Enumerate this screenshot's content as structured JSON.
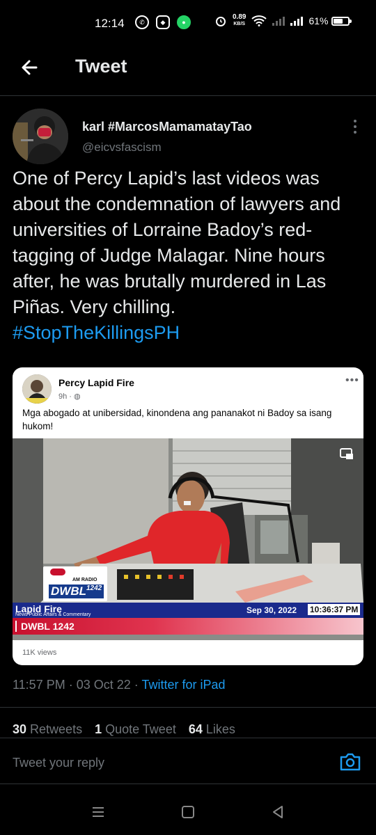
{
  "status_bar": {
    "time": "12:14",
    "speed_value": "0.89",
    "speed_unit": "KB/S",
    "battery": "61%"
  },
  "header": {
    "title": "Tweet",
    "back_icon": "arrow-left-icon"
  },
  "tweet": {
    "author_name": "karl #MarcosMamamatayTao",
    "author_handle": "@eicvsfascism",
    "text": "One of Percy Lapid’s last videos was about the condemnation of lawyers and universities of Lorraine Badoy’s red-tagging of Judge Malagar. Nine hours after, he was brutally murdered in Las Piñas. Very chilling.",
    "hashtag": "#StopTheKillingsPH",
    "timestamp": "11:57 PM · 03 Oct 22 · ",
    "client": "Twitter for iPad"
  },
  "embed": {
    "page_name": "Percy Lapid Fire",
    "post_time": "9h ·",
    "caption": "Mga abogado at unibersidad, kinondena ang pananakot ni Badoy sa isang hukom!",
    "views": "11K views",
    "logo_am": "AM RADIO",
    "logo_dwbl": "DWBL",
    "logo_freq": "1242",
    "overlay_show": "Lapid Fire",
    "overlay_sub": "News Public Affairs & Commentary",
    "overlay_station": "DWBL 1242",
    "overlay_date": "Sep 30, 2022",
    "overlay_clock": "10:36:37 PM"
  },
  "stats": {
    "retweets_count": "30",
    "retweets_label": "Retweets",
    "quotes_count": "1",
    "quotes_label": "Quote Tweet",
    "likes_count": "64",
    "likes_label": "Likes"
  },
  "reply": {
    "placeholder": "Tweet your reply"
  },
  "colors": {
    "background": "#000000",
    "accent": "#1d9bf0",
    "secondary_text": "#71767b"
  }
}
